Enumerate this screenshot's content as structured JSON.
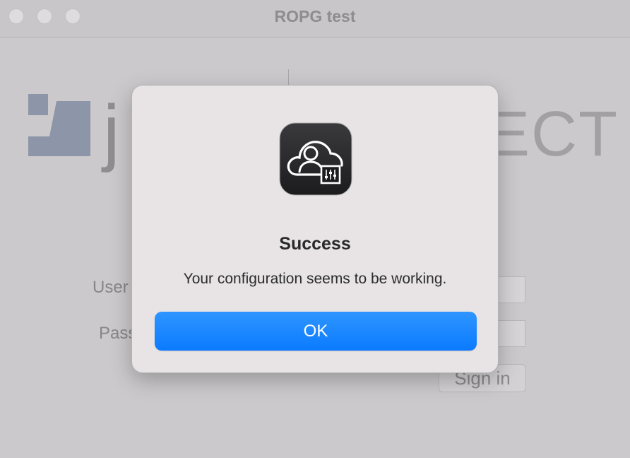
{
  "window": {
    "title": "ROPG test"
  },
  "background": {
    "logo_text": "j",
    "logo_right_text": "ECT",
    "username_label": "User",
    "password_label": "Pass",
    "signin_label": "Sign in"
  },
  "dialog": {
    "icon": "cloud-user-settings-icon",
    "title": "Success",
    "message": "Your configuration seems to be working.",
    "ok_label": "OK"
  },
  "colors": {
    "accent": "#0a7bff",
    "dialog_bg": "#e8e4e5",
    "window_bg": "#cbc9cb"
  }
}
